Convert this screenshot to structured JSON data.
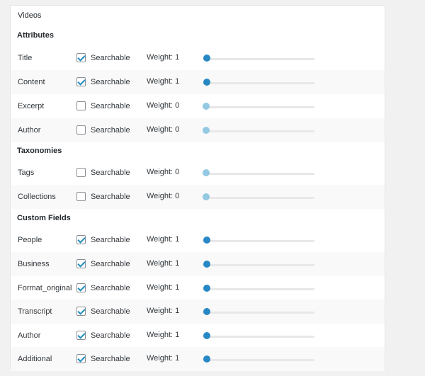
{
  "panel": {
    "title": "Videos",
    "sections": {
      "attributes": "Attributes",
      "taxonomies": "Taxonomies",
      "custom_fields": "Custom Fields"
    }
  },
  "searchable_label": "Searchable",
  "slider_max": 5,
  "rows": [
    {
      "label": "Title",
      "checked": true,
      "weight": 1,
      "weight_text": "Weight: 1"
    },
    {
      "label": "Content",
      "checked": true,
      "weight": 1,
      "weight_text": "Weight: 1"
    },
    {
      "label": "Excerpt",
      "checked": false,
      "weight": 0,
      "weight_text": "Weight: 0"
    },
    {
      "label": "Author",
      "checked": false,
      "weight": 0,
      "weight_text": "Weight: 0"
    },
    {
      "label": "Tags",
      "checked": false,
      "weight": 0,
      "weight_text": "Weight: 0"
    },
    {
      "label": "Collections",
      "checked": false,
      "weight": 0,
      "weight_text": "Weight: 0"
    },
    {
      "label": "People",
      "checked": true,
      "weight": 1,
      "weight_text": "Weight: 1"
    },
    {
      "label": "Business",
      "checked": true,
      "weight": 1,
      "weight_text": "Weight: 1"
    },
    {
      "label": "Format_original",
      "checked": true,
      "weight": 1,
      "weight_text": "Weight: 1"
    },
    {
      "label": "Transcript",
      "checked": true,
      "weight": 1,
      "weight_text": "Weight: 1"
    },
    {
      "label": "Author",
      "checked": true,
      "weight": 1,
      "weight_text": "Weight: 1"
    },
    {
      "label": "Additional",
      "checked": true,
      "weight": 1,
      "weight_text": "Weight: 1"
    }
  ]
}
